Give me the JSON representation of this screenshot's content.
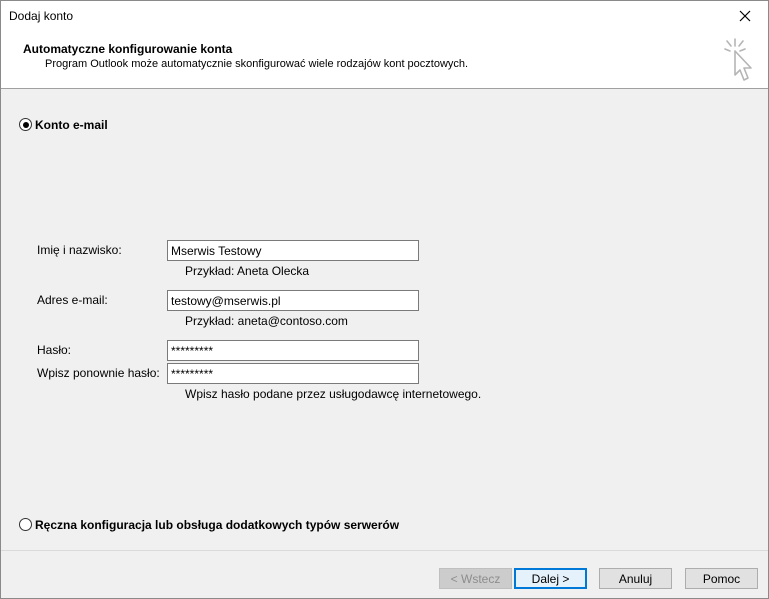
{
  "window": {
    "title": "Dodaj konto"
  },
  "header": {
    "title": "Automatyczne konfigurowanie konta",
    "subtitle": "Program Outlook może automatycznie skonfigurować wiele rodzajów kont pocztowych."
  },
  "options": {
    "email_account_label": "Konto e-mail",
    "email_account_selected": true,
    "manual_config_label": "Ręczna konfiguracja lub obsługa dodatkowych typów serwerów",
    "manual_config_selected": false
  },
  "form": {
    "name_label": "Imię i nazwisko:",
    "name_value": "Mserwis Testowy",
    "name_hint": "Przykład: Aneta Olecka",
    "email_label": "Adres e-mail:",
    "email_value": "testowy@mserwis.pl",
    "email_hint": "Przykład: aneta@contoso.com",
    "password_label": "Hasło:",
    "password_value": "*********",
    "password_confirm_label": "Wpisz ponownie hasło:",
    "password_confirm_value": "*********",
    "password_hint": "Wpisz hasło podane przez usługodawcę internetowego."
  },
  "buttons": {
    "back": "< Wstecz",
    "next": "Dalej >",
    "cancel": "Anuluj",
    "help": "Pomoc"
  },
  "icons": {
    "close": "close-icon",
    "header": "cursor-click-icon"
  }
}
